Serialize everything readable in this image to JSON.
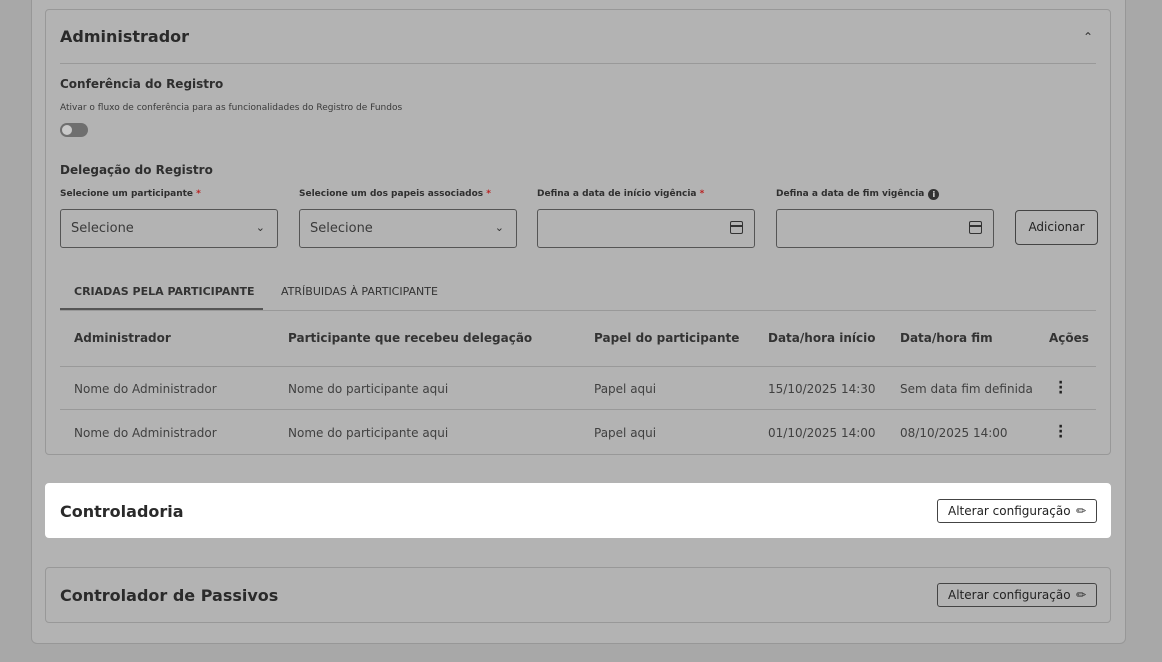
{
  "admin": {
    "title": "Administrador",
    "collapse_icon": "chevron-up-icon",
    "conferencia": {
      "title": "Conferência do Registro",
      "description": "Ativar o fluxo de conferência para as funcionalidades do Registro de Fundos",
      "toggle_on": false
    },
    "delegacao": {
      "title": "Delegação do Registro",
      "fields": [
        {
          "label": "Selecione um participante",
          "required": "*",
          "value": "Selecione"
        },
        {
          "label": "Selecione um dos papeis associados",
          "required": "*",
          "value": "Selecione"
        },
        {
          "label": "Defina a data de início vigência",
          "required": "*",
          "value": ""
        },
        {
          "label": "Defina a data de fim vigência",
          "required": "",
          "value": ""
        }
      ],
      "add_button": "Adicionar"
    },
    "tabs": [
      "CRIADAS PELA PARTICIPANTE",
      "ATRÍBUIDAS À PARTICIPANTE"
    ],
    "table": {
      "headers": [
        "Administrador",
        "Participante que recebeu delegação",
        "Papel do participante",
        "Data/hora início",
        "Data/hora fim",
        "Ações"
      ],
      "rows": [
        [
          "Nome do Administrador",
          "Nome do participante aqui",
          "Papel aqui",
          "15/10/2025 14:30",
          "Sem data fim definida"
        ],
        [
          "Nome do Administrador",
          "Nome do participante aqui",
          "Papel aqui",
          "01/10/2025 14:00",
          "08/10/2025 14:00"
        ]
      ]
    }
  },
  "controladoria": {
    "title": "Controladoria",
    "button": "Alterar configuração"
  },
  "passivos": {
    "title": "Controlador de Passivos",
    "button": "Alterar configuração"
  }
}
